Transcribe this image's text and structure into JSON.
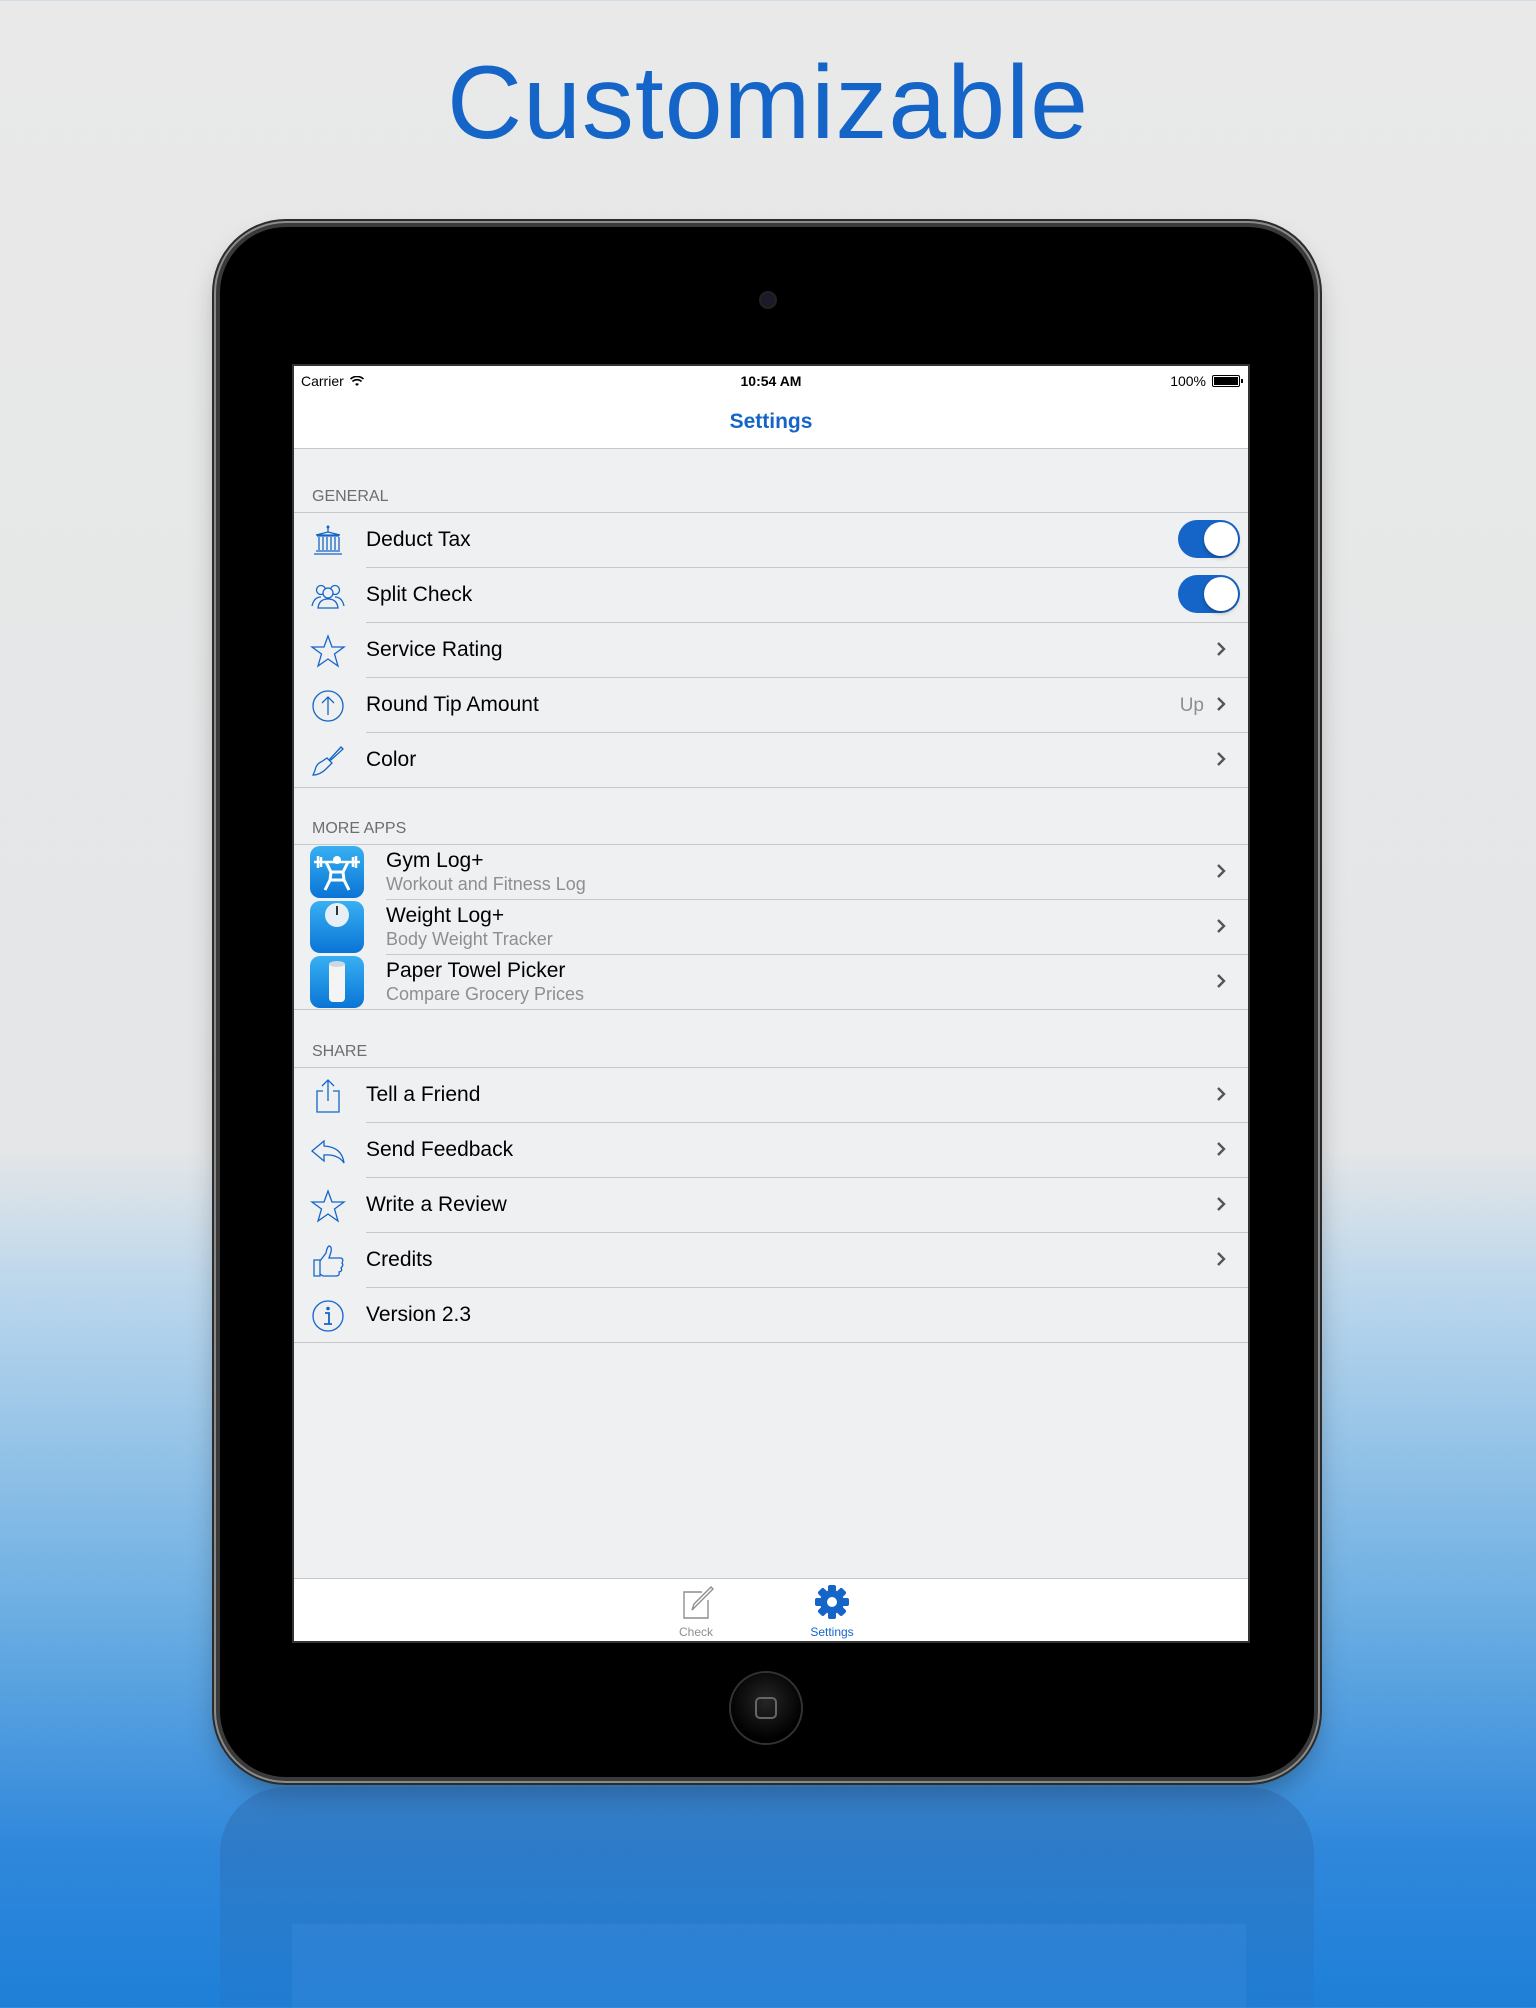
{
  "headline": "Customizable",
  "status_bar": {
    "carrier": "Carrier",
    "time": "10:54 AM",
    "battery": "100%"
  },
  "nav": {
    "title": "Settings"
  },
  "sections": {
    "general": {
      "header": "GENERAL",
      "items": [
        {
          "label": "Deduct Tax",
          "icon": "bank-icon",
          "toggle": true
        },
        {
          "label": "Split Check",
          "icon": "people-icon",
          "toggle": true
        },
        {
          "label": "Service Rating",
          "icon": "star-icon"
        },
        {
          "label": "Round Tip Amount",
          "icon": "arrow-up-circle-icon",
          "detail": "Up"
        },
        {
          "label": "Color",
          "icon": "paintbrush-icon"
        }
      ]
    },
    "more_apps": {
      "header": "MORE APPS",
      "items": [
        {
          "name": "Gym Log+",
          "subtitle": "Workout and Fitness Log",
          "icon": "weightlifter-icon"
        },
        {
          "name": "Weight Log+",
          "subtitle": "Body Weight Tracker",
          "icon": "scale-icon"
        },
        {
          "name": "Paper Towel Picker",
          "subtitle": "Compare Grocery Prices",
          "icon": "paper-towel-icon"
        }
      ]
    },
    "share": {
      "header": "SHARE",
      "items": [
        {
          "label": "Tell a Friend",
          "icon": "share-icon"
        },
        {
          "label": "Send Feedback",
          "icon": "reply-icon"
        },
        {
          "label": "Write a Review",
          "icon": "star-icon"
        },
        {
          "label": "Credits",
          "icon": "thumbs-up-icon"
        },
        {
          "label": "Version 2.3",
          "icon": "info-icon"
        }
      ]
    }
  },
  "tabs": [
    {
      "label": "Check",
      "icon": "pencil-edit-icon",
      "selected": false
    },
    {
      "label": "Settings",
      "icon": "gear-icon",
      "selected": true
    }
  ],
  "colors": {
    "accent": "#1565c8",
    "screen_bg": "#eef0f2",
    "secondary_text": "#8e8e93"
  }
}
